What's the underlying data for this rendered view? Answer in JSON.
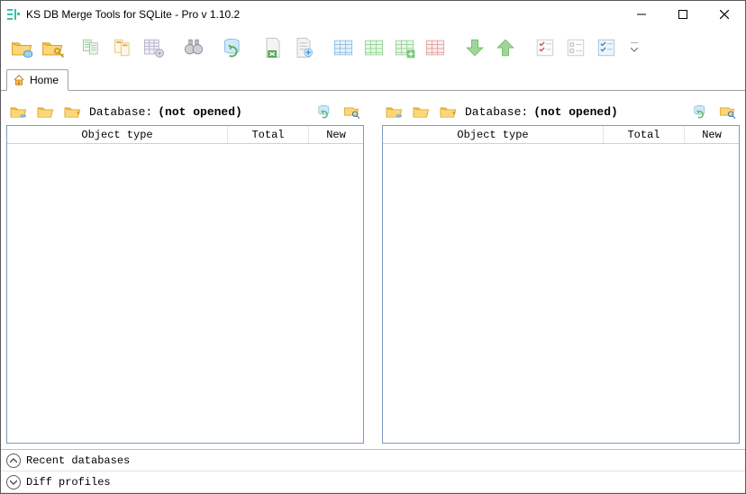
{
  "window": {
    "title": "KS DB Merge Tools for SQLite - Pro v 1.10.2"
  },
  "tabs": {
    "home": {
      "label": "Home"
    }
  },
  "toolbar": {
    "items": [
      "open-db",
      "open-db-key",
      "sep",
      "compare-list",
      "compare-selected",
      "compare-settings",
      "sep",
      "find",
      "sep",
      "sync",
      "sep",
      "export-excel",
      "export-csv",
      "sep",
      "table-blue",
      "table-green",
      "table-green-add",
      "table-red",
      "sep",
      "merge-down",
      "merge-up",
      "sep",
      "checklist-red",
      "checklist-plain",
      "checklist-blue"
    ]
  },
  "panes": {
    "left": {
      "db_label": "Database:",
      "db_status": "(not opened)",
      "columns": {
        "object": "Object type",
        "total": "Total",
        "new": "New"
      }
    },
    "right": {
      "db_label": "Database:",
      "db_status": "(not opened)",
      "columns": {
        "object": "Object type",
        "total": "Total",
        "new": "New"
      }
    }
  },
  "expanders": {
    "recent": "Recent databases",
    "profiles": "Diff profiles"
  },
  "colors": {
    "folder_base": "#f7c24a",
    "folder_shadow": "#d99a1e",
    "green": "#6bbf4b",
    "blue": "#3f8fd6",
    "red": "#e06666",
    "teal": "#3bbfa8",
    "grey": "#a8a8a8"
  }
}
